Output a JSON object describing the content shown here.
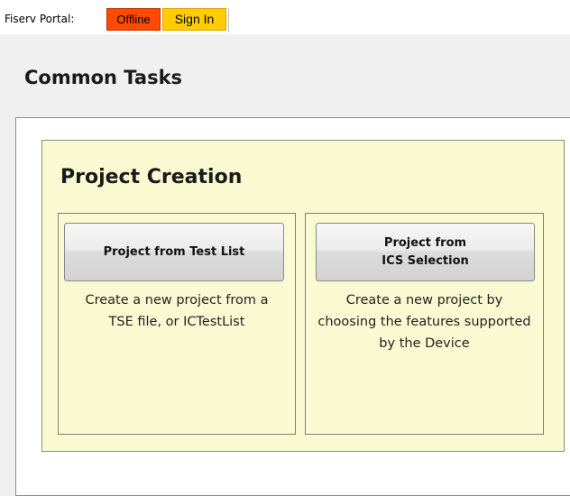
{
  "header": {
    "portal_label": "Fiserv Portal:",
    "status": "Offline",
    "signin_label": "Sign In"
  },
  "colors": {
    "status_offline": "#ff4a00",
    "signin": "#ffcc00",
    "panel": "#fafad2"
  },
  "main": {
    "title": "Common Tasks",
    "project_creation": {
      "title": "Project Creation",
      "tasks": [
        {
          "button_label": "Project from Test List",
          "description": "Create a new project from a TSE file, or ICTestList"
        },
        {
          "button_line1": "Project from",
          "button_line2": "ICS Selection",
          "description": "Create a new project by choosing the features supported by the Device"
        }
      ]
    }
  }
}
